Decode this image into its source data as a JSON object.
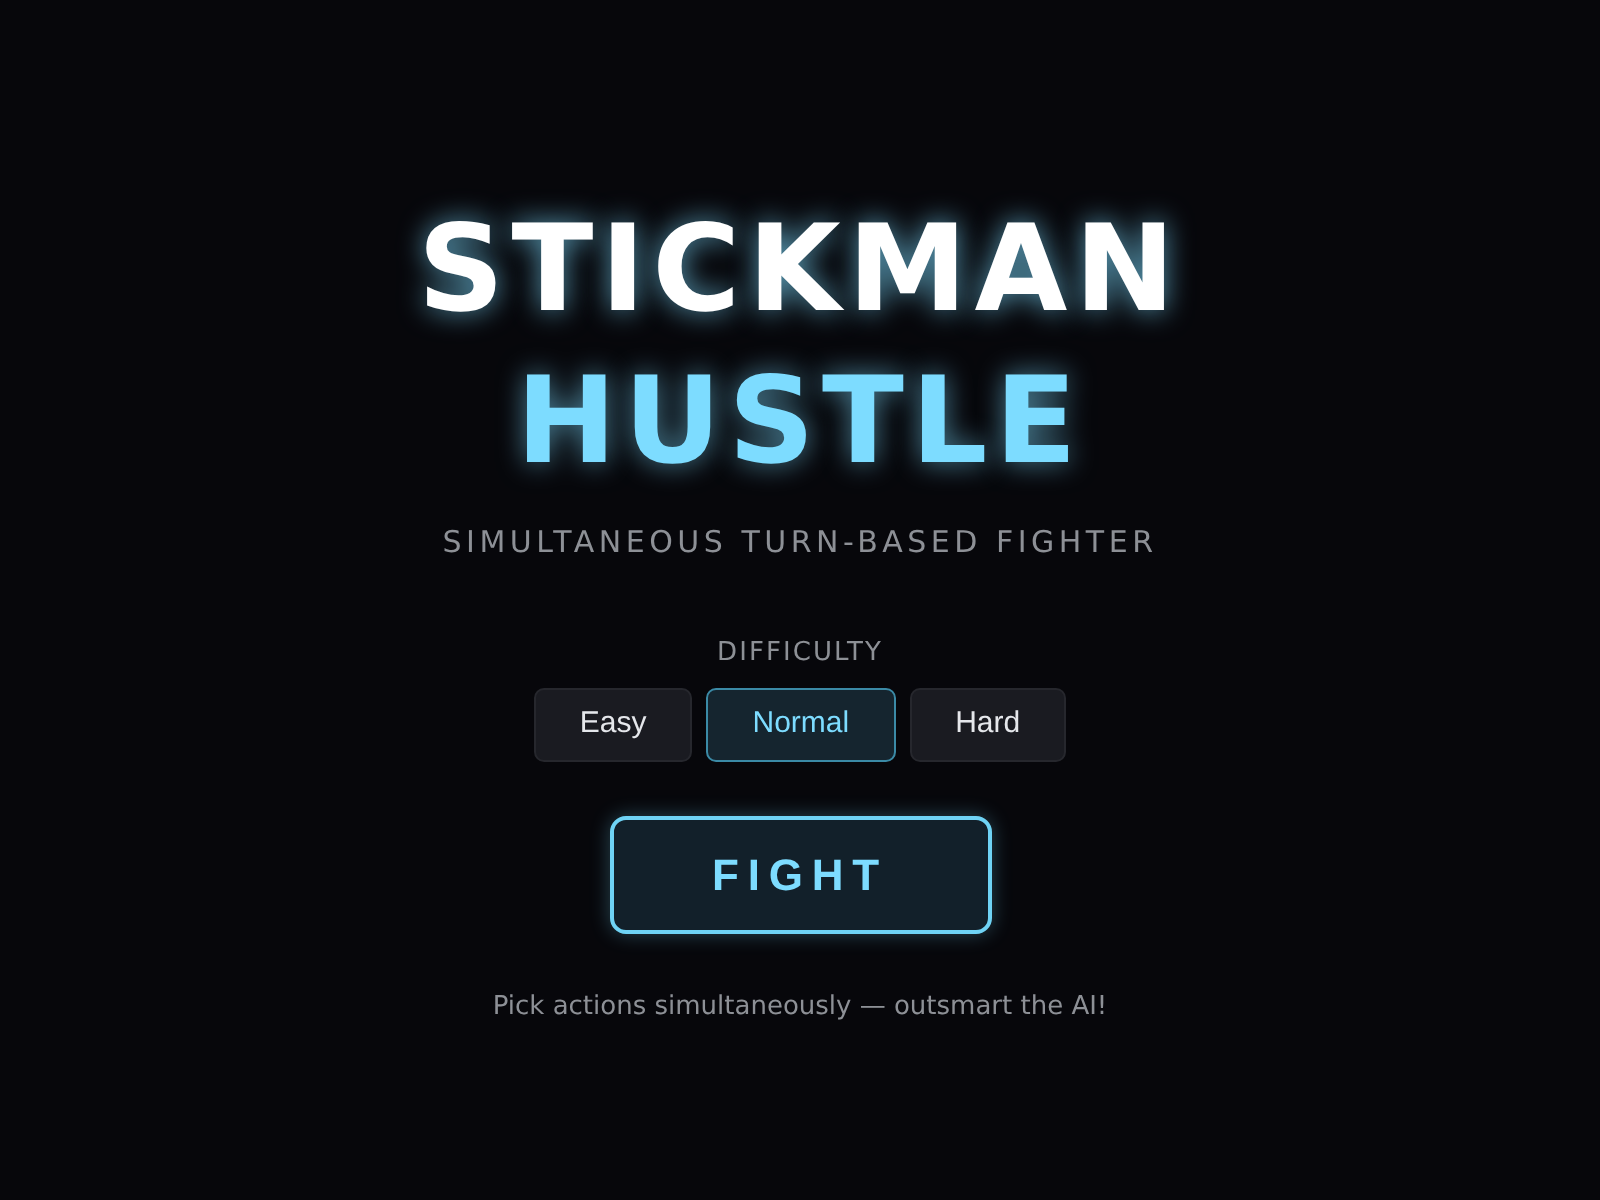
{
  "title": {
    "line_1": "STICKMAN",
    "line_2": "HUSTLE"
  },
  "subtitle": "SIMULTANEOUS TURN-BASED FIGHTER",
  "difficulty": {
    "label": "DIFFICULTY",
    "options": [
      {
        "label": "Easy",
        "selected": false
      },
      {
        "label": "Normal",
        "selected": true
      },
      {
        "label": "Hard",
        "selected": false
      }
    ]
  },
  "fight_button": "FIGHT",
  "footer": "Pick actions simultaneously — outsmart the AI!"
}
